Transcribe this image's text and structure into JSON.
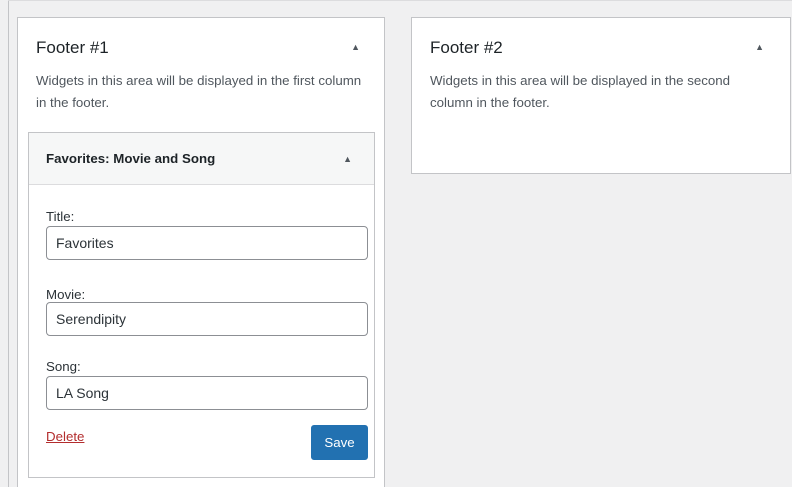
{
  "areas": [
    {
      "title": "Footer #1",
      "toggle": "▲",
      "description": "Widgets in this area will be displayed in the first column in the footer."
    },
    {
      "title": "Footer #2",
      "toggle": "▲",
      "description": "Widgets in this area will be displayed in the second column in the footer."
    }
  ],
  "widget": {
    "title": "Favorites: Movie and Song",
    "toggle": "▲",
    "fields": {
      "title": {
        "label": "Title:",
        "value": "Favorites"
      },
      "movie": {
        "label": "Movie:",
        "value": "Serendipity"
      },
      "song": {
        "label": "Song:",
        "value": "LA Song"
      }
    },
    "delete_label": "Delete",
    "save_label": "Save"
  },
  "colors": {
    "primary_button": "#2271b1",
    "delete_link": "#b32d2e"
  }
}
